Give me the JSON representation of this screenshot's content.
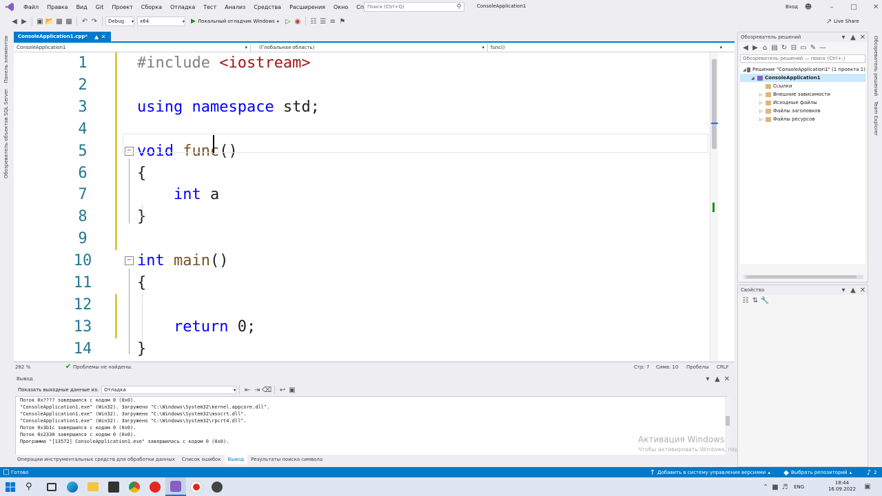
{
  "menubar": {
    "items": [
      "Файл",
      "Правка",
      "Вид",
      "Git",
      "Проект",
      "Сборка",
      "Отладка",
      "Тест",
      "Анализ",
      "Средства",
      "Расширения",
      "Окно",
      "Справка"
    ],
    "search_placeholder": "Поиск (Ctrl+Q)",
    "solution_title": "ConsoleApplication1",
    "signin": "Вход"
  },
  "toolbar": {
    "config": "Debug",
    "platform": "x64",
    "run_label": "Локальный отладчик Windows",
    "live_share": "Live Share"
  },
  "left_rail": [
    "Панель элементов",
    "Обозреватель объектов SQL Server"
  ],
  "tab": {
    "title": "ConsoleApplication1.cpp*"
  },
  "navbar": {
    "project": "ConsoleApplication1",
    "scope": "(Глобальная область)",
    "member": "func()"
  },
  "editor": {
    "lines": [
      {
        "num": "1",
        "parts": [
          {
            "t": "#include ",
            "c": "pre"
          },
          {
            "t": "<iostream>",
            "c": "str"
          }
        ]
      },
      {
        "num": "2",
        "parts": []
      },
      {
        "num": "3",
        "parts": [
          {
            "t": "using",
            "c": "kw"
          },
          {
            "t": " ",
            "c": ""
          },
          {
            "t": "namespace",
            "c": "kw"
          },
          {
            "t": " std;",
            "c": ""
          }
        ]
      },
      {
        "num": "4",
        "parts": []
      },
      {
        "num": "5",
        "parts": [
          {
            "t": "void",
            "c": "kw"
          },
          {
            "t": " ",
            "c": ""
          },
          {
            "t": "func",
            "c": "fn"
          },
          {
            "t": "()",
            "c": ""
          }
        ]
      },
      {
        "num": "6",
        "parts": [
          {
            "t": "{",
            "c": ""
          }
        ]
      },
      {
        "num": "7",
        "parts": [
          {
            "t": "    ",
            "c": ""
          },
          {
            "t": "int",
            "c": "kw"
          },
          {
            "t": " a",
            "c": ""
          }
        ]
      },
      {
        "num": "8",
        "parts": [
          {
            "t": "}",
            "c": ""
          }
        ]
      },
      {
        "num": "9",
        "parts": []
      },
      {
        "num": "10",
        "parts": [
          {
            "t": "int",
            "c": "kw"
          },
          {
            "t": " ",
            "c": ""
          },
          {
            "t": "main",
            "c": "fn"
          },
          {
            "t": "()",
            "c": ""
          }
        ]
      },
      {
        "num": "11",
        "parts": [
          {
            "t": "{",
            "c": ""
          }
        ]
      },
      {
        "num": "12",
        "parts": []
      },
      {
        "num": "13",
        "parts": [
          {
            "t": "    ",
            "c": ""
          },
          {
            "t": "return",
            "c": "kw"
          },
          {
            "t": " 0;",
            "c": ""
          }
        ]
      },
      {
        "num": "14",
        "parts": [
          {
            "t": "}",
            "c": ""
          }
        ]
      }
    ]
  },
  "editor_status": {
    "zoom": "282 %",
    "issues": "Проблемы не найдены.",
    "position": "Стр: 7",
    "char": "Симв: 10",
    "spaces": "Пробелы",
    "eol": "CRLF"
  },
  "output": {
    "title": "Вывод",
    "show_from_label": "Показать выходные данные из:",
    "show_from_value": "Отладка",
    "lines": [
      "Поток 0x???? завершился с кодом 0 (0x0).",
      "\"ConsoleApplication1.exe\" (Win32). Загружено \"C:\\Windows\\System32\\kernel.appcore.dll\".",
      "\"ConsoleApplication1.exe\" (Win32). Загружено \"C:\\Windows\\System32\\msvcrt.dll\".",
      "\"ConsoleApplication1.exe\" (Win32). Загружено \"C:\\Windows\\System32\\rpcrt4.dll\".",
      "Поток 0x3b1c завершился с кодом 0 (0x0).",
      "Поток 0x2330 завершился с кодом 0 (0x0).",
      "Программа \"[13572] ConsoleApplication1.exe\" завершилась с кодом 0 (0x0)."
    ],
    "tabs": [
      "Операции инструментальных средств для обработки данных",
      "Список ошибок",
      "Вывод",
      "Результаты поиска символа"
    ],
    "active_tab": 2
  },
  "watermark": {
    "line1": "Активация Windows",
    "line2": "Чтобы активировать Windows, перейдите в раздел \"Параметры\"."
  },
  "solution_explorer": {
    "title": "Обозреватель решений",
    "search_placeholder": "Обозреватель решений — поиск (Ctrl+;)",
    "items": [
      {
        "label": "Решение \"ConsoleApplication1\" (1 проекта 1)",
        "indent": 0,
        "selected": false
      },
      {
        "label": "ConsoleApplication1",
        "indent": 1,
        "selected": true
      },
      {
        "label": "Ссылки",
        "indent": 2,
        "selected": false
      },
      {
        "label": "Внешние зависимости",
        "indent": 2,
        "selected": false
      },
      {
        "label": "Исходные файлы",
        "indent": 2,
        "selected": false
      },
      {
        "label": "Файлы заголовков",
        "indent": 2,
        "selected": false
      },
      {
        "label": "Файлы ресурсов",
        "indent": 2,
        "selected": false
      }
    ]
  },
  "properties": {
    "title": "Свойства"
  },
  "right_rail": [
    "Обозреватель решений",
    "Team Explorer"
  ],
  "statusbar": {
    "ready": "Готово",
    "add_vcs": "Добавить в систему управления версиями",
    "select_repo": "Выбрать репозиторий",
    "notifications": "2"
  },
  "taskbar": {
    "lang": "ENG",
    "time": "18:44",
    "date": "16.09.2022"
  }
}
